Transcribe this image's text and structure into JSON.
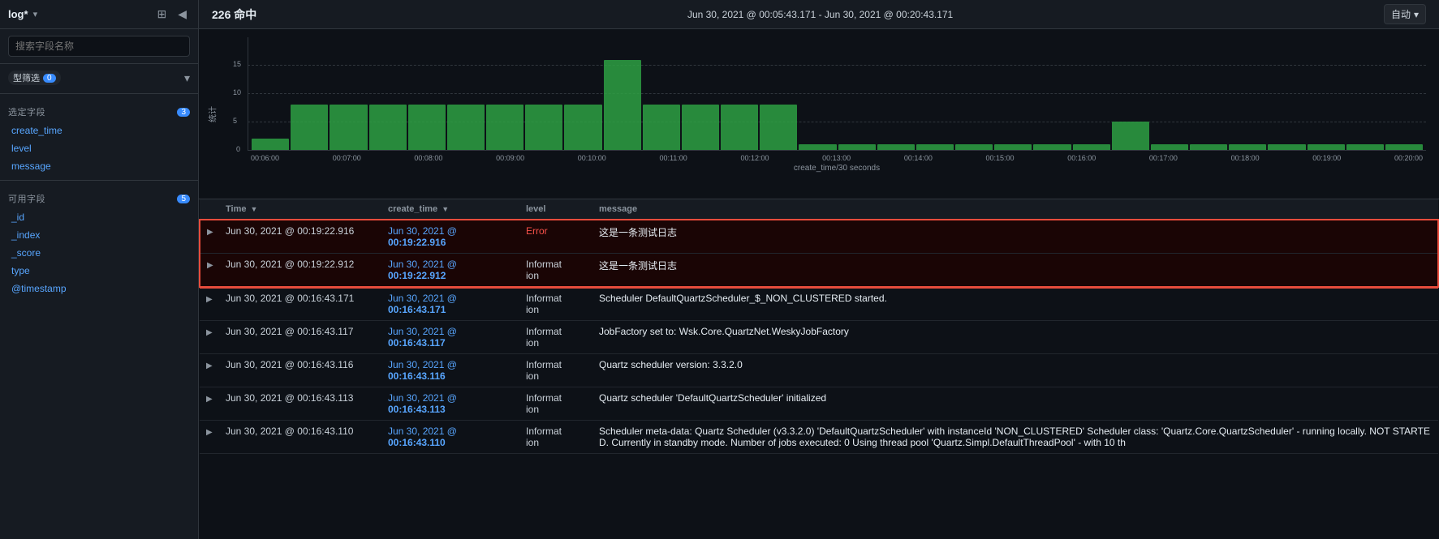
{
  "sidebar": {
    "title": "log*",
    "search_placeholder": "搜索字段名称",
    "type_filter": {
      "label": "型筛选",
      "count": 0
    },
    "selected_fields": {
      "label": "选定字段",
      "count": 3
    },
    "selected_field_items": [
      "create_time",
      "level",
      "message"
    ],
    "available_fields": {
      "label": "可用字段",
      "count": 5
    },
    "available_field_items": [
      "_id",
      "_index",
      "_score",
      "type",
      "@timestamp"
    ]
  },
  "topbar": {
    "hit_count": "226 命中",
    "time_range": "Jun 30, 2021 @ 00:05:43.171 - Jun 30, 2021 @ 00:20:43.171",
    "auto_label": "自动"
  },
  "chart": {
    "y_label": "统计",
    "x_axis_title": "create_time/30 seconds",
    "x_labels": [
      "00:06:00",
      "00:07:00",
      "00:08:00",
      "00:09:00",
      "00:10:00",
      "00:11:00",
      "00:12:00",
      "00:13:00",
      "00:14:00",
      "00:15:00",
      "00:16:00",
      "00:17:00",
      "00:18:00",
      "00:19:00",
      "00:20:00"
    ],
    "y_ticks": [
      0,
      5,
      10,
      15
    ],
    "bars": [
      2,
      8,
      8,
      8,
      8,
      8,
      8,
      8,
      8,
      16,
      8,
      8,
      8,
      8,
      1,
      1,
      1,
      1,
      1,
      1,
      1,
      1,
      5,
      1,
      1,
      1,
      1,
      1,
      1,
      1
    ]
  },
  "table": {
    "columns": {
      "expand": "",
      "time": "Time",
      "create_time": "create_time",
      "level": "level",
      "message": "message"
    },
    "rows": [
      {
        "id": "row1",
        "highlighted": true,
        "time": "Jun 30, 2021 @ 00:19:22.916",
        "create_time": "Jun 30, 2021 @ 00:19:22.916",
        "level": "Error",
        "message": "这是一条测试日志"
      },
      {
        "id": "row2",
        "highlighted": true,
        "time": "Jun 30, 2021 @ 00:19:22.912",
        "create_time": "Jun 30, 2021 @ 00:19:22.912",
        "level": "Information",
        "message": "这是一条测试日志"
      },
      {
        "id": "row3",
        "highlighted": false,
        "time": "Jun 30, 2021 @ 00:16:43.171",
        "create_time": "Jun 30, 2021 @ 00:16:43.171",
        "level": "Information",
        "message": "Scheduler DefaultQuartzScheduler_$_NON_CLUSTERED started."
      },
      {
        "id": "row4",
        "highlighted": false,
        "time": "Jun 30, 2021 @ 00:16:43.117",
        "create_time": "Jun 30, 2021 @ 00:16:43.117",
        "level": "Information",
        "message": "JobFactory set to: Wsk.Core.QuartzNet.WeskyJobFactory"
      },
      {
        "id": "row5",
        "highlighted": false,
        "time": "Jun 30, 2021 @ 00:16:43.116",
        "create_time": "Jun 30, 2021 @ 00:16:43.116",
        "level": "Information",
        "message": "Quartz scheduler version: 3.3.2.0"
      },
      {
        "id": "row6",
        "highlighted": false,
        "time": "Jun 30, 2021 @ 00:16:43.113",
        "create_time": "Jun 30, 2021 @ 00:16:43.113",
        "level": "Information",
        "message": "Quartz scheduler 'DefaultQuartzScheduler' initialized"
      },
      {
        "id": "row7",
        "highlighted": false,
        "time": "Jun 30, 2021 @ 00:16:43.110",
        "create_time": "Jun 30, 2021 @ 00:16:43.110",
        "level": "Information",
        "message": "Scheduler meta-data: Quartz Scheduler (v3.3.2.0) 'DefaultQuartzScheduler' with instanceId 'NON_CLUSTERED' Scheduler class: 'Quartz.Core.QuartzScheduler' - running locally. NOT STARTED. Currently in standby mode. Number of jobs executed: 0 Using thread pool 'Quartz.Simpl.DefaultThreadPool' - with 10 th"
      }
    ]
  }
}
